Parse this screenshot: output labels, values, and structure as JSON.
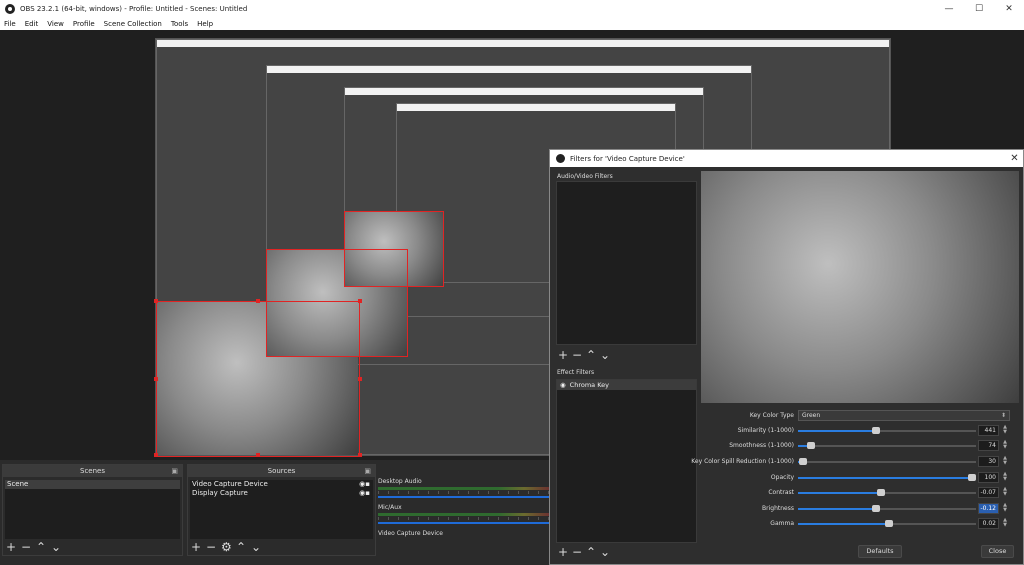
{
  "app": {
    "title": "OBS 23.2.1 (64-bit, windows) - Profile: Untitled - Scenes: Untitled",
    "minimize": "—",
    "maximize": "☐",
    "close": "✕"
  },
  "menu": [
    "File",
    "Edit",
    "View",
    "Profile",
    "Scene Collection",
    "Tools",
    "Help"
  ],
  "scenes": {
    "title": "Scenes",
    "items": [
      "Scene"
    ]
  },
  "sources": {
    "title": "Sources",
    "items": [
      "Video Capture Device",
      "Display Capture"
    ]
  },
  "mixer": {
    "channels": [
      "Desktop Audio",
      "Mic/Aux",
      "Video Capture Device"
    ]
  },
  "filters_dialog": {
    "title": "Filters for 'Video Capture Device'",
    "audio_video_label": "Audio/Video Filters",
    "effect_label": "Effect Filters",
    "effect_items": [
      "Chroma Key"
    ],
    "properties": {
      "key_color_type": {
        "label": "Key Color Type",
        "value": "Green"
      },
      "sliders": [
        {
          "label": "Similarity (1-1000)",
          "value": "441",
          "fraction": 0.441
        },
        {
          "label": "Smoothness (1-1000)",
          "value": "74",
          "fraction": 0.074
        },
        {
          "label": "Key Color Spill Reduction (1-1000)",
          "value": "30",
          "fraction": 0.03
        },
        {
          "label": "Opacity",
          "value": "100",
          "fraction": 1.0
        },
        {
          "label": "Contrast",
          "value": "-0.07",
          "fraction": 0.465
        },
        {
          "label": "Brightness",
          "value": "-0.12",
          "fraction": 0.44
        },
        {
          "label": "Gamma",
          "value": "0.02",
          "fraction": 0.51
        }
      ]
    },
    "defaults_label": "Defaults",
    "close_label": "Close"
  }
}
